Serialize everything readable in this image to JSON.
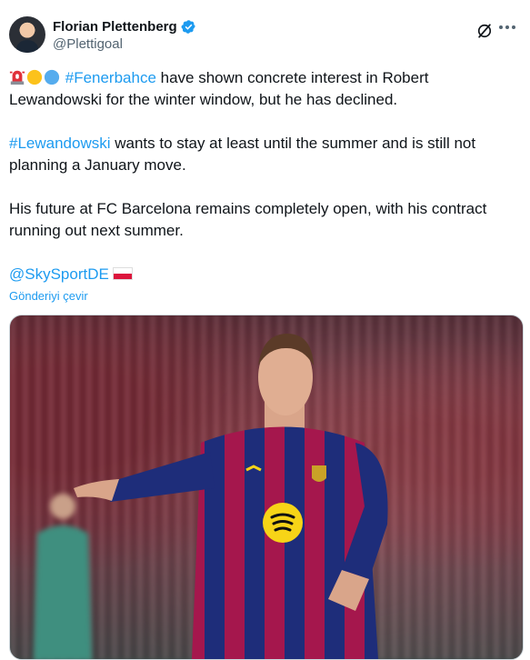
{
  "author": {
    "display_name": "Florian Plettenberg",
    "handle": "@Plettigoal",
    "verified": true
  },
  "tweet": {
    "para1_hashtag": "#Fenerbahce",
    "para1_text": " have shown concrete interest in Robert Lewandowski for the winter window, but he has declined.",
    "para2_hashtag": "#Lewandowski",
    "para2_text": " wants to stay at least until the summer and is still not planning a January move.",
    "para3_text": "His future at FC Barcelona remains completely open, with his contract running out next summer.",
    "mention": "@SkySportDE"
  },
  "translate_label": "Gönderiyi çevir",
  "icons": {
    "grok": "grok-icon",
    "more": "more-icon",
    "verified": "verified-badge-icon",
    "emoji": [
      "rotating-light-emoji",
      "yellow-circle-emoji",
      "blue-circle-emoji"
    ],
    "flag": "poland-flag-emoji"
  },
  "colors": {
    "accent": "#1d9bf0",
    "text": "#0f1419",
    "secondary": "#536471"
  }
}
